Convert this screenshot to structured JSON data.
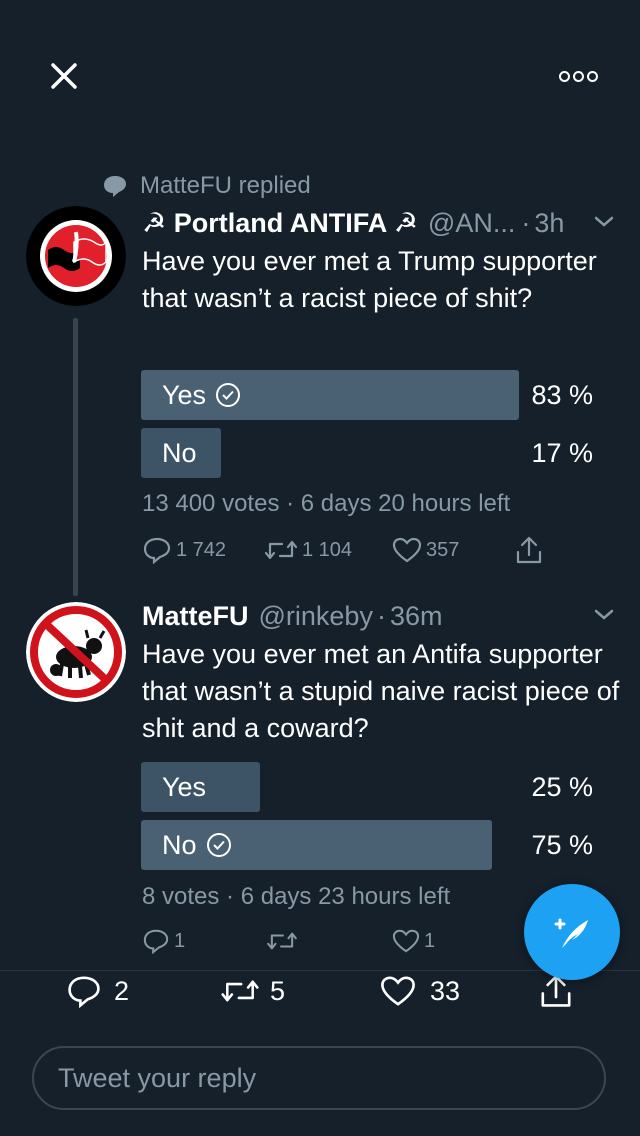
{
  "colors": {
    "background": "#15202b",
    "muted": "#8899a6",
    "poll_bar": "#3d5466",
    "accent": "#1da1f2"
  },
  "top_bar": {
    "close_icon": "close-icon",
    "more_icon": "more-icon"
  },
  "context": {
    "replied_text": "MatteFU replied",
    "icon": "speech-bubble-icon"
  },
  "tweet1": {
    "display_name": "☭ Portland ANTIFA ☭",
    "handle": "@AN...",
    "separator": "·",
    "time": "3h",
    "text": "Have you ever met a Trump supporter that wasn’t a racist piece of shit?",
    "poll": {
      "options": [
        {
          "label": "Yes",
          "percent_text": "83 %",
          "percent": 83,
          "winner": true
        },
        {
          "label": "No",
          "percent_text": "17 %",
          "percent": 17,
          "winner": false
        }
      ],
      "meta": "13 400 votes · 6 days 20 hours left"
    },
    "actions": {
      "replies": "1 742",
      "retweets": "1 104",
      "likes": "357"
    }
  },
  "tweet2": {
    "display_name": "MatteFU",
    "handle": "@rinkeby",
    "separator": "·",
    "time": "36m",
    "text": "Have you ever met an Antifa supporter that wasn’t a stupid naive racist piece of shit and a coward?",
    "poll": {
      "options": [
        {
          "label": "Yes",
          "percent_text": "25 %",
          "percent": 25,
          "winner": false
        },
        {
          "label": "No",
          "percent_text": "75 %",
          "percent": 75,
          "winner": true
        }
      ],
      "meta": "8 votes · 6 days 23 hours left"
    },
    "actions": {
      "replies": "1",
      "retweets": "",
      "likes": "1"
    }
  },
  "bottom_actions": {
    "replies": "2",
    "retweets": "5",
    "likes": "33"
  },
  "reply_box": {
    "placeholder": "Tweet your reply"
  }
}
